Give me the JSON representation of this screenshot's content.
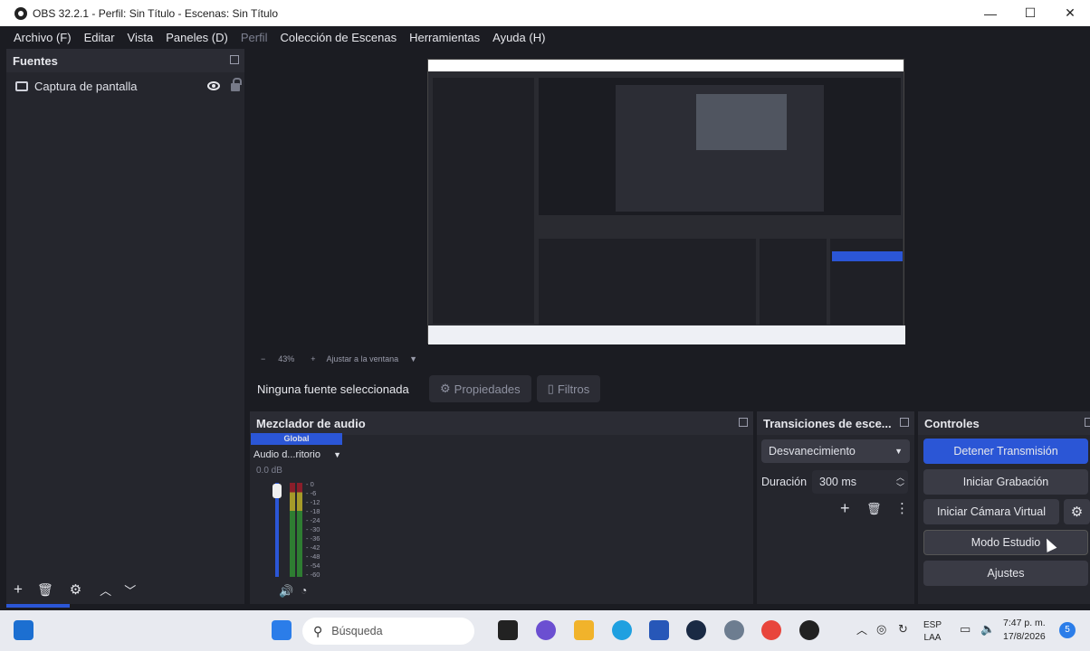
{
  "window": {
    "title": "OBS 32.2.1 - Perfil: Sin Título - Escenas: Sin Título"
  },
  "menu": [
    "Archivo (F)",
    "Editar",
    "Vista",
    "Paneles (D)",
    "Perfil",
    "Colección de Escenas",
    "Herramientas",
    "Ayuda (H)"
  ],
  "sources": {
    "title": "Fuentes",
    "items": [
      {
        "label": "Captura de pantalla"
      }
    ]
  },
  "zoom": {
    "minus": "−",
    "value": "43%",
    "plus": "+",
    "fit": "Ajustar a la ventana"
  },
  "properties": {
    "no_source": "Ninguna fuente seleccionada",
    "props_btn": "Propiedades",
    "filters_btn": "Filtros"
  },
  "mixer": {
    "title": "Mezclador de audio",
    "tab": "Global",
    "device": "Audio d...ritorio",
    "db": "0.0 dB",
    "scale": [
      "0",
      "-6",
      "-12",
      "-18",
      "-24",
      "-30",
      "-36",
      "-42",
      "-48",
      "-54",
      "-60"
    ],
    "level": 0.0
  },
  "transitions": {
    "title": "Transiciones de esce...",
    "selected": "Desvanecimiento",
    "duration_label": "Duración",
    "duration_value": "300 ms"
  },
  "controls": {
    "title": "Controles",
    "stop_stream": "Detener Transmisión",
    "start_recording": "Iniciar Grabación",
    "virtual_cam": "Iniciar Cámara Virtual",
    "studio_mode": "Modo Estudio",
    "settings": "Ajustes"
  },
  "taskbar": {
    "search": "Búsqueda",
    "lang": "ESP",
    "lang2": "LAA",
    "time": "7:47 p. m.",
    "date": "17/8/2026",
    "notif": "5"
  },
  "colors": {
    "accent": "#2b56d6",
    "panel": "#25262d",
    "bg": "#1b1c22"
  }
}
